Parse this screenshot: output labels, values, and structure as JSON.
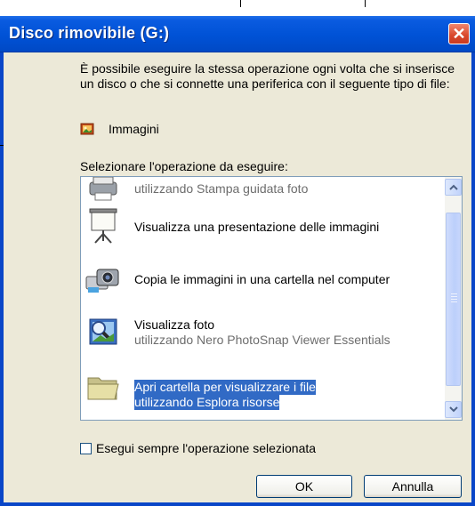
{
  "window": {
    "title": "Disco rimovibile (G:)"
  },
  "description": "È possibile eseguire la stessa operazione ogni volta che si inserisce un disco o che si connette una periferica con il seguente tipo di file:",
  "file_type": {
    "icon": "images-file-icon",
    "label": "Immagini"
  },
  "select_label": "Selezionare l'operazione da eseguire:",
  "actions": [
    {
      "icon": "printer-icon",
      "line1": "",
      "line2": "utilizzando Stampa guidata foto"
    },
    {
      "icon": "projector-screen-icon",
      "line1": "Visualizza una presentazione delle immagini",
      "line2": ""
    },
    {
      "icon": "camera-copy-icon",
      "line1": "Copia le immagini in una cartella nel computer",
      "line2": ""
    },
    {
      "icon": "photo-viewer-icon",
      "line1": "Visualizza foto",
      "line2": "utilizzando Nero PhotoSnap Viewer Essentials"
    },
    {
      "icon": "folder-icon",
      "line1": "Apri cartella per visualizzare i file",
      "line2": "utilizzando Esplora risorse",
      "selected": true
    }
  ],
  "always_checkbox": {
    "label": "Esegui sempre l'operazione selezionata",
    "checked": false
  },
  "buttons": {
    "ok": "OK",
    "cancel": "Annulla"
  },
  "colors": {
    "titlebar": "#0052d6",
    "selection": "#316ac5",
    "client": "#ece9d8"
  }
}
